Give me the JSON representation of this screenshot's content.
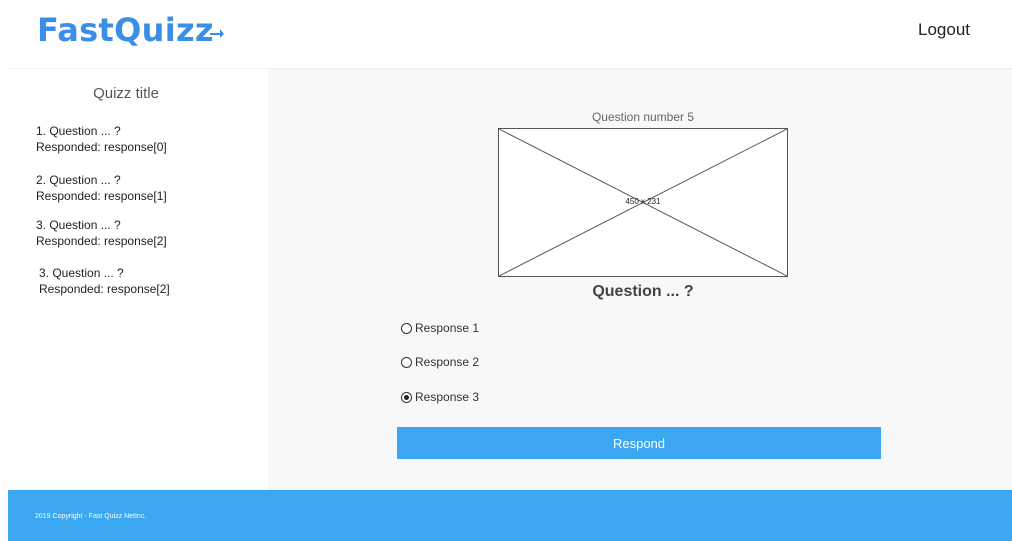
{
  "header": {
    "logo": "FastQuizz",
    "logout_label": "Logout",
    "brand_color": "#3b8ee8"
  },
  "sidebar": {
    "title": "Quizz title",
    "items": [
      {
        "question": "1. Question ... ?",
        "responded": "Responded: response[0]"
      },
      {
        "question": "2. Question ... ?",
        "responded": "Responded: response[1]"
      },
      {
        "question": "3. Question ... ?",
        "responded": "Responded: response[2]"
      },
      {
        "question": "3. Question ... ?",
        "responded": "Responded: response[2]"
      }
    ]
  },
  "content": {
    "question_number": "Question number 5",
    "image_placeholder_label": "450 x 231",
    "question_text": "Question ... ?",
    "options": [
      {
        "label": "Response 1",
        "selected": false
      },
      {
        "label": "Response 2",
        "selected": false
      },
      {
        "label": "Response 3",
        "selected": true
      }
    ],
    "respond_label": "Respond",
    "accent_color": "#3aa7f0"
  },
  "footer": {
    "copyright": "2019 Copyright - Fast Quizz NetInc."
  }
}
